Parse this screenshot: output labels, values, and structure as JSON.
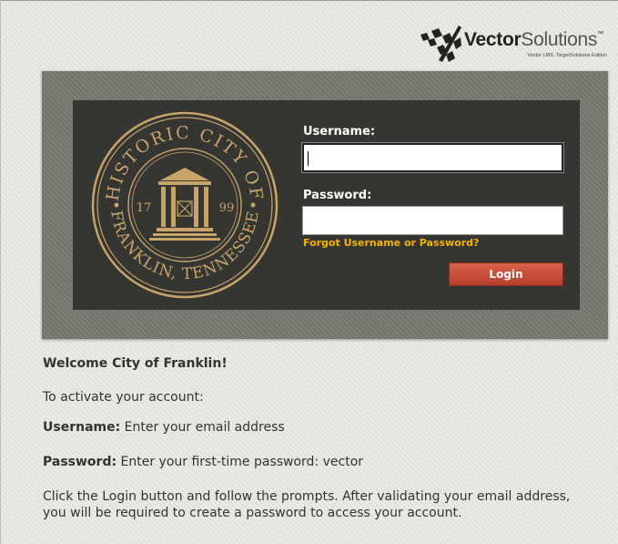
{
  "logo": {
    "brand_bold": "Vector",
    "brand_light": "Solutions",
    "trademark": "™",
    "subtitle": "Vector LMS, TargetSolutions Edition",
    "icon": "vector-solutions-logo-mark"
  },
  "seal": {
    "top_text": "HISTORIC CITY OF",
    "bottom_text": "FRANKLIN, TENNESSEE",
    "year_left": "17",
    "year_right": "99",
    "icon": "city-seal-courthouse"
  },
  "form": {
    "username_label": "Username:",
    "username_value": "",
    "password_label": "Password:",
    "password_value": "",
    "forgot_link": "Forgot Username or Password?",
    "login_button": "Login"
  },
  "instructions": {
    "welcome": "Welcome City of Franklin!",
    "activate": "To activate your account:",
    "username_label": "Username:",
    "username_text": " Enter your email address",
    "password_label": "Password:",
    "password_text": " Enter your first-time password: vector",
    "line1": "Click the Login button and follow the prompts. After validating your email address,",
    "line2": "you will be required to create a password to access your account."
  },
  "colors": {
    "login_button": "#c54b37",
    "forgot_link": "#f4b400",
    "panel_dark": "#353532",
    "panel_outer": "#77766f",
    "seal_gold": "#c9a46a"
  }
}
